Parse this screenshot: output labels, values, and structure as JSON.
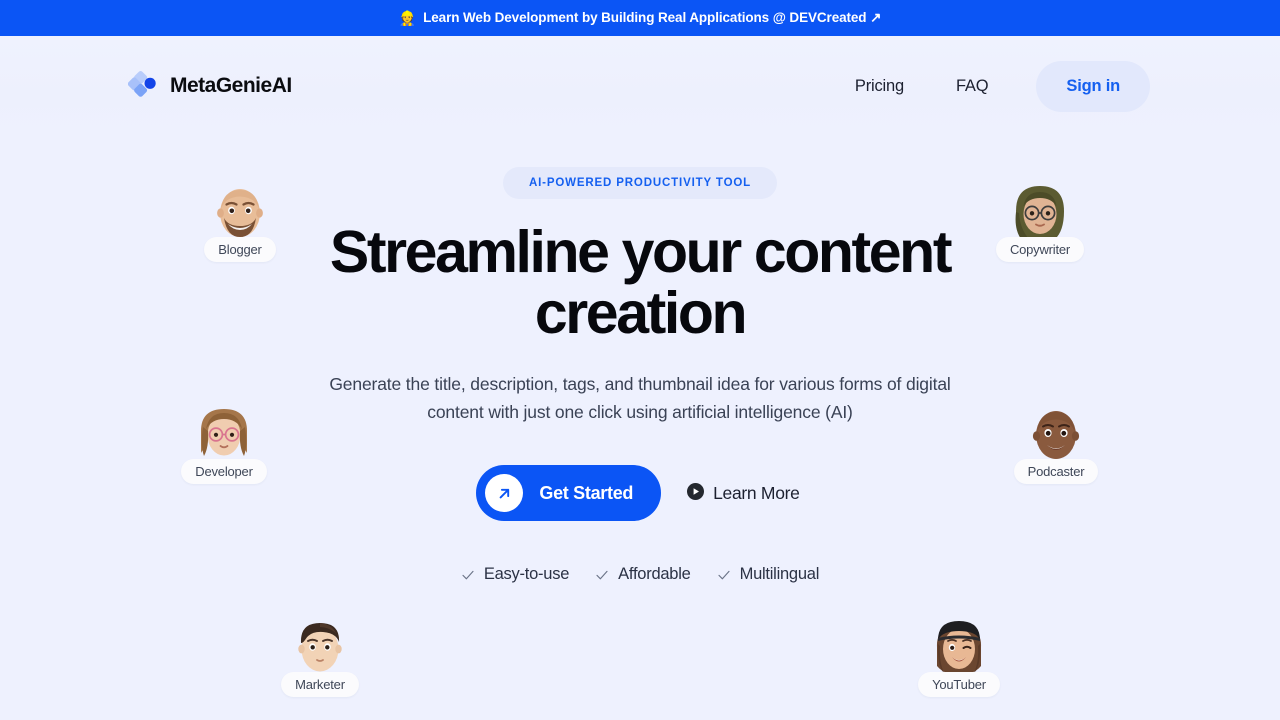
{
  "banner": {
    "emoji": "👷",
    "text": "Learn Web Development by Building Real Applications @ DEVCreated ↗",
    "bg_color": "#0b55f5"
  },
  "header": {
    "brand_name": "MetaGenieAI",
    "logo_icon": "diamond-cluster-logo",
    "nav": [
      {
        "label": "Pricing"
      },
      {
        "label": "FAQ"
      }
    ],
    "signin_label": "Sign in",
    "signin_color": "#1560f0"
  },
  "hero": {
    "badge": "AI-POWERED PRODUCTIVITY TOOL",
    "headline": "Streamline your content creation",
    "subhead": "Generate the title, description, tags, and thumbnail idea for various forms of digital content with just one click using artificial intelligence (AI)",
    "primary_cta": {
      "label": "Get Started",
      "icon": "arrow-up-right-icon",
      "color": "#0b55f5"
    },
    "secondary_cta": {
      "label": "Learn More",
      "icon": "play-circle-icon"
    },
    "features": [
      {
        "label": "Easy-to-use",
        "icon": "check-icon"
      },
      {
        "label": "Affordable",
        "icon": "check-icon"
      },
      {
        "label": "Multilingual",
        "icon": "check-icon"
      }
    ]
  },
  "personas": [
    {
      "label": "Blogger",
      "skin": "#e8bd98",
      "hair": "#5d4331",
      "style": "bald-beard"
    },
    {
      "label": "Copywriter",
      "skin": "#e0b494",
      "hair": "#55552e",
      "style": "hijab-glasses"
    },
    {
      "label": "Developer",
      "skin": "#f0cdb0",
      "hair": "#a5764a",
      "style": "long-hair-glasses"
    },
    {
      "label": "Podcaster",
      "skin": "#8a5a3e",
      "hair": "#3a2418",
      "style": "bald"
    },
    {
      "label": "Marketer",
      "skin": "#f2d3b6",
      "hair": "#3b2a20",
      "style": "short-hair"
    },
    {
      "label": "YouTuber",
      "skin": "#e8b894",
      "hair": "#6b4630",
      "style": "beanie-wink"
    }
  ],
  "theme": {
    "page_bg": "#eef1fe",
    "accent": "#0b55f5",
    "text": "#0b0c10"
  }
}
